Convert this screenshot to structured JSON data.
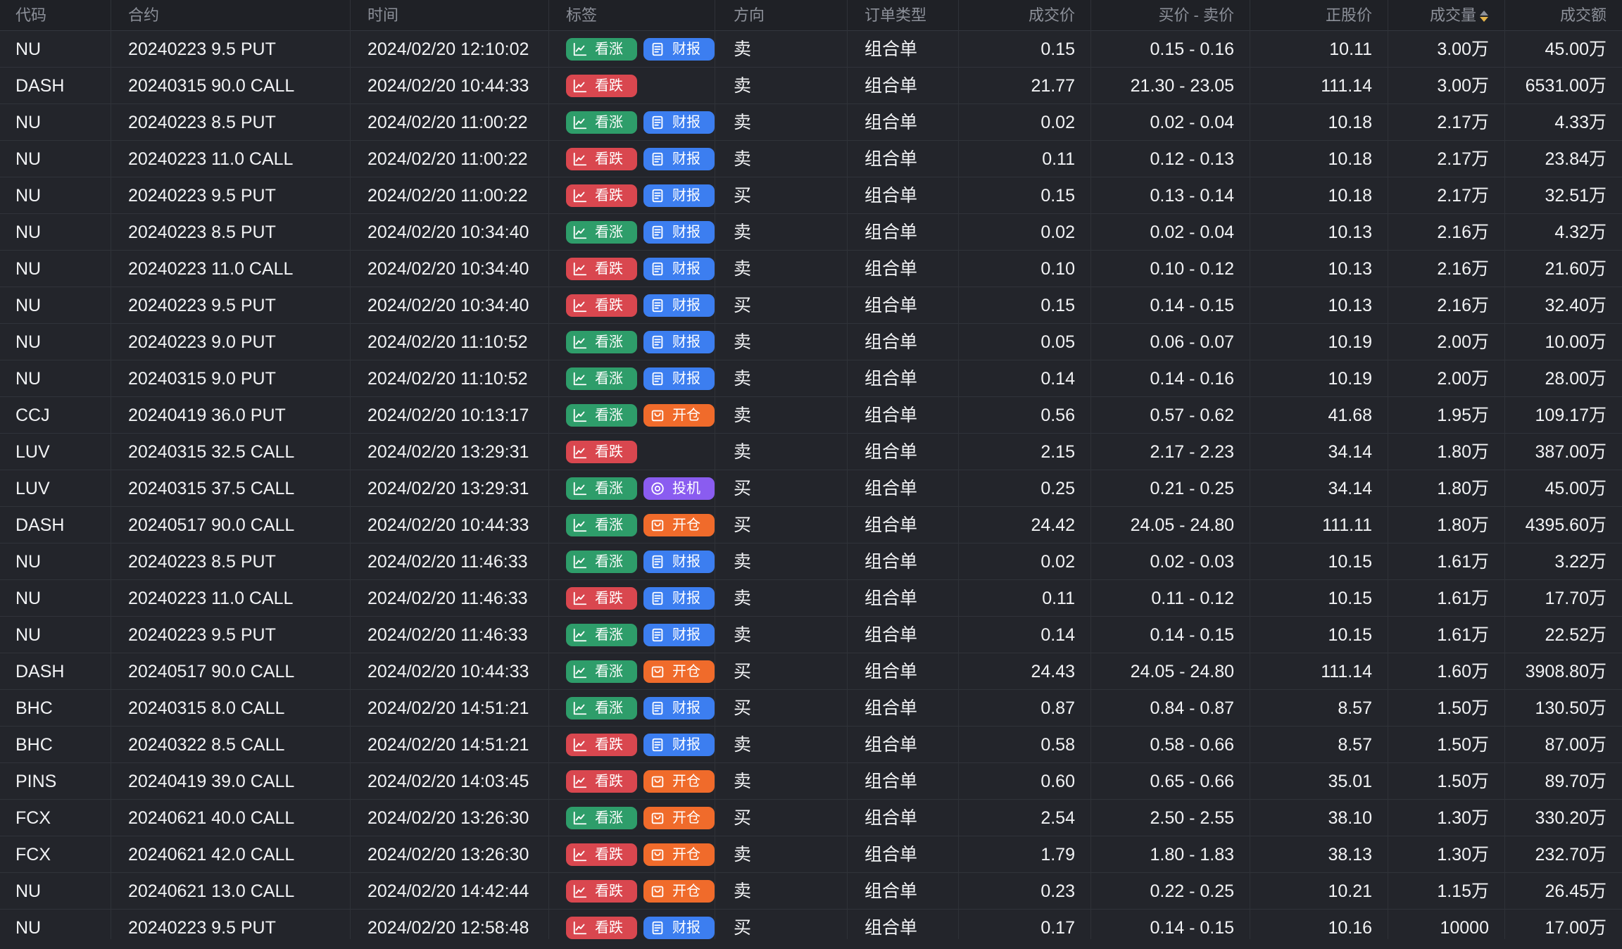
{
  "header": {
    "code": "代码",
    "contract": "合约",
    "time": "时间",
    "tags": "标签",
    "direction": "方向",
    "order_type": "订单类型",
    "price": "成交价",
    "bid_ask": "买价 - 卖价",
    "stock_price": "正股价",
    "volume": "成交量",
    "amount": "成交额"
  },
  "colors": {
    "bullish": "#2e9d6a",
    "bearish": "#d9474f",
    "earnings": "#3c7ef0",
    "open": "#f06b2b",
    "speculative": "#8a5cf0",
    "sort_active": "#e3b34a"
  },
  "rows": [
    {
      "code": "NU",
      "contract": "20240223 9.5 PUT",
      "time": "2024/02/20 12:10:02",
      "tag1": "看涨",
      "tag1_kind": "up",
      "tag2": "财报",
      "tag2_kind": "earnings",
      "direction": "卖",
      "order_type": "组合单",
      "price": "0.15",
      "bid_ask": "0.15 - 0.16",
      "stock_price": "10.11",
      "volume": "3.00万",
      "amount": "45.00万"
    },
    {
      "code": "DASH",
      "contract": "20240315 90.0 CALL",
      "time": "2024/02/20 10:44:33",
      "tag1": "看跌",
      "tag1_kind": "down",
      "tag2": "",
      "tag2_kind": "",
      "direction": "卖",
      "order_type": "组合单",
      "price": "21.77",
      "bid_ask": "21.30 - 23.05",
      "stock_price": "111.14",
      "volume": "3.00万",
      "amount": "6531.00万"
    },
    {
      "code": "NU",
      "contract": "20240223 8.5 PUT",
      "time": "2024/02/20 11:00:22",
      "tag1": "看涨",
      "tag1_kind": "up",
      "tag2": "财报",
      "tag2_kind": "earnings",
      "direction": "卖",
      "order_type": "组合单",
      "price": "0.02",
      "bid_ask": "0.02 - 0.04",
      "stock_price": "10.18",
      "volume": "2.17万",
      "amount": "4.33万"
    },
    {
      "code": "NU",
      "contract": "20240223 11.0 CALL",
      "time": "2024/02/20 11:00:22",
      "tag1": "看跌",
      "tag1_kind": "down",
      "tag2": "财报",
      "tag2_kind": "earnings",
      "direction": "卖",
      "order_type": "组合单",
      "price": "0.11",
      "bid_ask": "0.12 - 0.13",
      "stock_price": "10.18",
      "volume": "2.17万",
      "amount": "23.84万"
    },
    {
      "code": "NU",
      "contract": "20240223 9.5 PUT",
      "time": "2024/02/20 11:00:22",
      "tag1": "看跌",
      "tag1_kind": "down",
      "tag2": "财报",
      "tag2_kind": "earnings",
      "direction": "买",
      "order_type": "组合单",
      "price": "0.15",
      "bid_ask": "0.13 - 0.14",
      "stock_price": "10.18",
      "volume": "2.17万",
      "amount": "32.51万"
    },
    {
      "code": "NU",
      "contract": "20240223 8.5 PUT",
      "time": "2024/02/20 10:34:40",
      "tag1": "看涨",
      "tag1_kind": "up",
      "tag2": "财报",
      "tag2_kind": "earnings",
      "direction": "卖",
      "order_type": "组合单",
      "price": "0.02",
      "bid_ask": "0.02 - 0.04",
      "stock_price": "10.13",
      "volume": "2.16万",
      "amount": "4.32万"
    },
    {
      "code": "NU",
      "contract": "20240223 11.0 CALL",
      "time": "2024/02/20 10:34:40",
      "tag1": "看跌",
      "tag1_kind": "down",
      "tag2": "财报",
      "tag2_kind": "earnings",
      "direction": "卖",
      "order_type": "组合单",
      "price": "0.10",
      "bid_ask": "0.10 - 0.12",
      "stock_price": "10.13",
      "volume": "2.16万",
      "amount": "21.60万"
    },
    {
      "code": "NU",
      "contract": "20240223 9.5 PUT",
      "time": "2024/02/20 10:34:40",
      "tag1": "看跌",
      "tag1_kind": "down",
      "tag2": "财报",
      "tag2_kind": "earnings",
      "direction": "买",
      "order_type": "组合单",
      "price": "0.15",
      "bid_ask": "0.14 - 0.15",
      "stock_price": "10.13",
      "volume": "2.16万",
      "amount": "32.40万"
    },
    {
      "code": "NU",
      "contract": "20240223 9.0 PUT",
      "time": "2024/02/20 11:10:52",
      "tag1": "看涨",
      "tag1_kind": "up",
      "tag2": "财报",
      "tag2_kind": "earnings",
      "direction": "卖",
      "order_type": "组合单",
      "price": "0.05",
      "bid_ask": "0.06 - 0.07",
      "stock_price": "10.19",
      "volume": "2.00万",
      "amount": "10.00万"
    },
    {
      "code": "NU",
      "contract": "20240315 9.0 PUT",
      "time": "2024/02/20 11:10:52",
      "tag1": "看涨",
      "tag1_kind": "up",
      "tag2": "财报",
      "tag2_kind": "earnings",
      "direction": "卖",
      "order_type": "组合单",
      "price": "0.14",
      "bid_ask": "0.14 - 0.16",
      "stock_price": "10.19",
      "volume": "2.00万",
      "amount": "28.00万"
    },
    {
      "code": "CCJ",
      "contract": "20240419 36.0 PUT",
      "time": "2024/02/20 10:13:17",
      "tag1": "看涨",
      "tag1_kind": "up",
      "tag2": "开仓",
      "tag2_kind": "open",
      "direction": "卖",
      "order_type": "组合单",
      "price": "0.56",
      "bid_ask": "0.57 - 0.62",
      "stock_price": "41.68",
      "volume": "1.95万",
      "amount": "109.17万"
    },
    {
      "code": "LUV",
      "contract": "20240315 32.5 CALL",
      "time": "2024/02/20 13:29:31",
      "tag1": "看跌",
      "tag1_kind": "down",
      "tag2": "",
      "tag2_kind": "",
      "direction": "卖",
      "order_type": "组合单",
      "price": "2.15",
      "bid_ask": "2.17 - 2.23",
      "stock_price": "34.14",
      "volume": "1.80万",
      "amount": "387.00万"
    },
    {
      "code": "LUV",
      "contract": "20240315 37.5 CALL",
      "time": "2024/02/20 13:29:31",
      "tag1": "看涨",
      "tag1_kind": "up",
      "tag2": "投机",
      "tag2_kind": "speculative",
      "direction": "买",
      "order_type": "组合单",
      "price": "0.25",
      "bid_ask": "0.21 - 0.25",
      "stock_price": "34.14",
      "volume": "1.80万",
      "amount": "45.00万"
    },
    {
      "code": "DASH",
      "contract": "20240517 90.0 CALL",
      "time": "2024/02/20 10:44:33",
      "tag1": "看涨",
      "tag1_kind": "up",
      "tag2": "开仓",
      "tag2_kind": "open",
      "direction": "买",
      "order_type": "组合单",
      "price": "24.42",
      "bid_ask": "24.05 - 24.80",
      "stock_price": "111.11",
      "volume": "1.80万",
      "amount": "4395.60万"
    },
    {
      "code": "NU",
      "contract": "20240223 8.5 PUT",
      "time": "2024/02/20 11:46:33",
      "tag1": "看涨",
      "tag1_kind": "up",
      "tag2": "财报",
      "tag2_kind": "earnings",
      "direction": "卖",
      "order_type": "组合单",
      "price": "0.02",
      "bid_ask": "0.02 - 0.03",
      "stock_price": "10.15",
      "volume": "1.61万",
      "amount": "3.22万"
    },
    {
      "code": "NU",
      "contract": "20240223 11.0 CALL",
      "time": "2024/02/20 11:46:33",
      "tag1": "看跌",
      "tag1_kind": "down",
      "tag2": "财报",
      "tag2_kind": "earnings",
      "direction": "卖",
      "order_type": "组合单",
      "price": "0.11",
      "bid_ask": "0.11 - 0.12",
      "stock_price": "10.15",
      "volume": "1.61万",
      "amount": "17.70万"
    },
    {
      "code": "NU",
      "contract": "20240223 9.5 PUT",
      "time": "2024/02/20 11:46:33",
      "tag1": "看涨",
      "tag1_kind": "up",
      "tag2": "财报",
      "tag2_kind": "earnings",
      "direction": "卖",
      "order_type": "组合单",
      "price": "0.14",
      "bid_ask": "0.14 - 0.15",
      "stock_price": "10.15",
      "volume": "1.61万",
      "amount": "22.52万"
    },
    {
      "code": "DASH",
      "contract": "20240517 90.0 CALL",
      "time": "2024/02/20 10:44:33",
      "tag1": "看涨",
      "tag1_kind": "up",
      "tag2": "开仓",
      "tag2_kind": "open",
      "direction": "买",
      "order_type": "组合单",
      "price": "24.43",
      "bid_ask": "24.05 - 24.80",
      "stock_price": "111.14",
      "volume": "1.60万",
      "amount": "3908.80万"
    },
    {
      "code": "BHC",
      "contract": "20240315 8.0 CALL",
      "time": "2024/02/20 14:51:21",
      "tag1": "看涨",
      "tag1_kind": "up",
      "tag2": "财报",
      "tag2_kind": "earnings",
      "direction": "买",
      "order_type": "组合单",
      "price": "0.87",
      "bid_ask": "0.84 - 0.87",
      "stock_price": "8.57",
      "volume": "1.50万",
      "amount": "130.50万"
    },
    {
      "code": "BHC",
      "contract": "20240322 8.5 CALL",
      "time": "2024/02/20 14:51:21",
      "tag1": "看跌",
      "tag1_kind": "down",
      "tag2": "财报",
      "tag2_kind": "earnings",
      "direction": "卖",
      "order_type": "组合单",
      "price": "0.58",
      "bid_ask": "0.58 - 0.66",
      "stock_price": "8.57",
      "volume": "1.50万",
      "amount": "87.00万"
    },
    {
      "code": "PINS",
      "contract": "20240419 39.0 CALL",
      "time": "2024/02/20 14:03:45",
      "tag1": "看跌",
      "tag1_kind": "down",
      "tag2": "开仓",
      "tag2_kind": "open",
      "direction": "卖",
      "order_type": "组合单",
      "price": "0.60",
      "bid_ask": "0.65 - 0.66",
      "stock_price": "35.01",
      "volume": "1.50万",
      "amount": "89.70万"
    },
    {
      "code": "FCX",
      "contract": "20240621 40.0 CALL",
      "time": "2024/02/20 13:26:30",
      "tag1": "看涨",
      "tag1_kind": "up",
      "tag2": "开仓",
      "tag2_kind": "open",
      "direction": "买",
      "order_type": "组合单",
      "price": "2.54",
      "bid_ask": "2.50 - 2.55",
      "stock_price": "38.10",
      "volume": "1.30万",
      "amount": "330.20万"
    },
    {
      "code": "FCX",
      "contract": "20240621 42.0 CALL",
      "time": "2024/02/20 13:26:30",
      "tag1": "看跌",
      "tag1_kind": "down",
      "tag2": "开仓",
      "tag2_kind": "open",
      "direction": "卖",
      "order_type": "组合单",
      "price": "1.79",
      "bid_ask": "1.80 - 1.83",
      "stock_price": "38.13",
      "volume": "1.30万",
      "amount": "232.70万"
    },
    {
      "code": "NU",
      "contract": "20240621 13.0 CALL",
      "time": "2024/02/20 14:42:44",
      "tag1": "看跌",
      "tag1_kind": "down",
      "tag2": "开仓",
      "tag2_kind": "open",
      "direction": "卖",
      "order_type": "组合单",
      "price": "0.23",
      "bid_ask": "0.22 - 0.25",
      "stock_price": "10.21",
      "volume": "1.15万",
      "amount": "26.45万"
    },
    {
      "code": "NU",
      "contract": "20240223 9.5 PUT",
      "time": "2024/02/20 12:58:48",
      "tag1": "看跌",
      "tag1_kind": "down",
      "tag2": "财报",
      "tag2_kind": "earnings",
      "direction": "买",
      "order_type": "组合单",
      "price": "0.17",
      "bid_ask": "0.14 - 0.15",
      "stock_price": "10.16",
      "volume": "10000",
      "amount": "17.00万"
    }
  ]
}
